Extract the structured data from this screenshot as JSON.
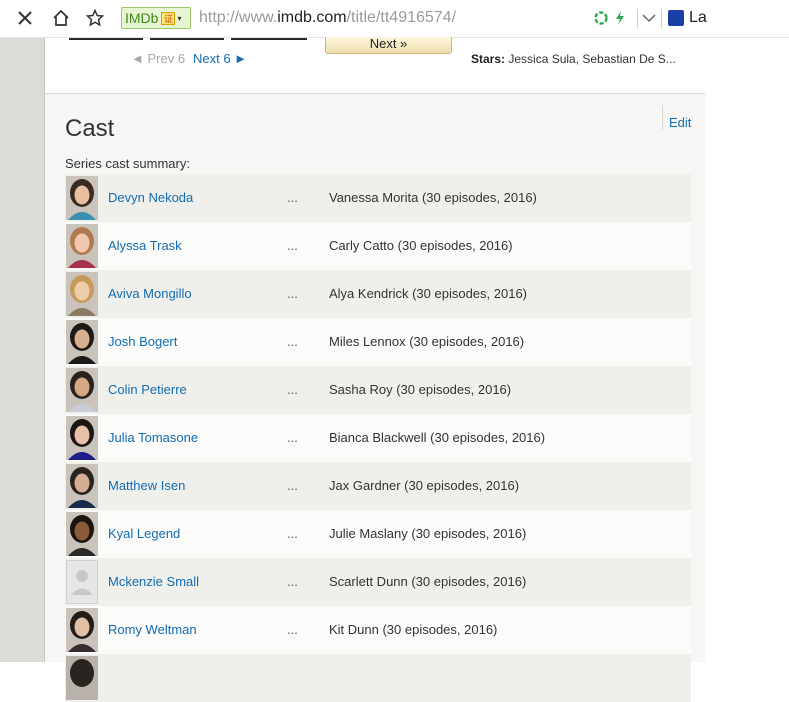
{
  "browser": {
    "url_prefix": "http://www.",
    "url_domain": "imdb.com",
    "url_path": "/title/tt4916574/",
    "badge_label": "IMDb",
    "badge_cert_glyph": "证",
    "toolbar_cut_text": "La"
  },
  "nav": {
    "prev_label": "◄ Prev 6",
    "next_label": "Next 6 ►",
    "next_button_label": "Next »",
    "stars_label": "Stars:",
    "stars_value": " Jessica Sula, Sebastian De S..."
  },
  "cast": {
    "title": "Cast",
    "edit_label": "Edit",
    "summary_label": "Series cast summary:",
    "dots": "...",
    "members": [
      {
        "actor": "Devyn Nekoda",
        "role": "Vanessa Morita (30 episodes, 2016)",
        "skin": "#e8bfa0",
        "hair": "#3a2a20",
        "shirt": "#3a8fb0"
      },
      {
        "actor": "Alyssa Trask",
        "role": "Carly Catto (30 episodes, 2016)",
        "skin": "#f0c8b0",
        "hair": "#b07a50",
        "shirt": "#a8304a"
      },
      {
        "actor": "Aviva Mongillo",
        "role": "Alya Kendrick (30 episodes, 2016)",
        "skin": "#efcdaa",
        "hair": "#c89a5a",
        "shirt": "#8a7a60"
      },
      {
        "actor": "Josh Bogert",
        "role": "Miles Lennox (30 episodes, 2016)",
        "skin": "#d8b090",
        "hair": "#1e1a18",
        "shirt": "#1a1a1a"
      },
      {
        "actor": "Colin Petierre",
        "role": "Sasha Roy (30 episodes, 2016)",
        "skin": "#d6a882",
        "hair": "#2a2222",
        "shirt": "#c8ccd4"
      },
      {
        "actor": "Julia Tomasone",
        "role": "Bianca Blackwell (30 episodes, 2016)",
        "skin": "#e8c0a8",
        "hair": "#1c1616",
        "shirt": "#1e1e8a"
      },
      {
        "actor": "Matthew Isen",
        "role": "Jax Gardner (30 episodes, 2016)",
        "skin": "#d6ae92",
        "hair": "#2a2420",
        "shirt": "#1a2a4a"
      },
      {
        "actor": "Kyal Legend",
        "role": "Julie Maslany (30 episodes, 2016)",
        "skin": "#8a5a3a",
        "hair": "#1a1412",
        "shirt": "#2a2a2a"
      },
      {
        "actor": "Mckenzie Small",
        "role": "Scarlett Dunn (30 episodes, 2016)",
        "placeholder": true
      },
      {
        "actor": "Romy Weltman",
        "role": "Kit Dunn (30 episodes, 2016)",
        "skin": "#e2c0a6",
        "hair": "#241c18",
        "shirt": "#3a2a32"
      }
    ]
  }
}
